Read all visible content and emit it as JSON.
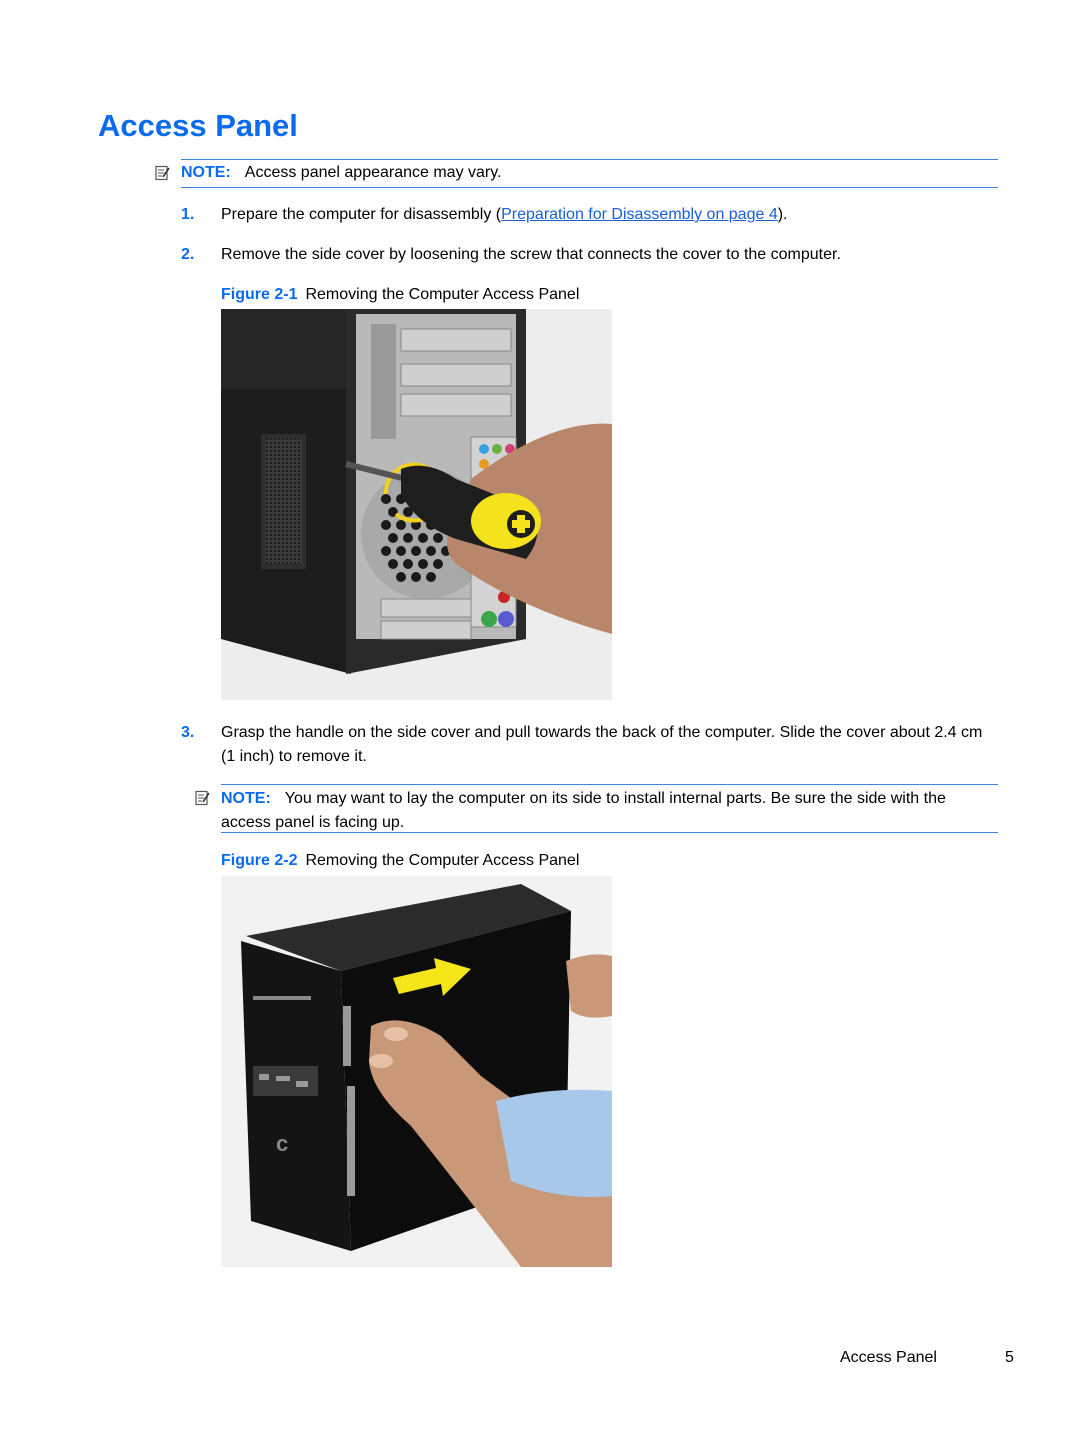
{
  "page": {
    "title": "Access Panel",
    "notes": [
      {
        "label": "NOTE:",
        "text": "Access panel appearance may vary.",
        "icon": "note-icon"
      },
      {
        "label": "NOTE:",
        "text": "You may want to lay the computer on its side to install internal parts. Be sure the side with the access panel is facing up.",
        "icon": "note-icon"
      }
    ],
    "steps": [
      {
        "num": "1.",
        "text_before": "Prepare the computer for disassembly (",
        "link": "Preparation for Disassembly on page 4",
        "text_after": ")."
      },
      {
        "num": "2.",
        "text": "Remove the side cover by loosening the screw that connects the cover to the computer."
      },
      {
        "num": "3.",
        "text": "Grasp the handle on the side cover and pull towards the back of the computer. Slide the cover about 2.4 cm (1 inch) to remove it."
      }
    ],
    "figures": [
      {
        "label": "Figure 2-1",
        "caption": "Removing the Computer Access Panel"
      },
      {
        "label": "Figure 2-2",
        "caption": "Removing the Computer Access Panel"
      }
    ],
    "footer": {
      "section": "Access Panel",
      "page_number": "5"
    },
    "colors": {
      "accent": "#0a6af0",
      "link": "#1a5fd6",
      "rule": "#3b86e6",
      "arrow": "#f5e61a"
    }
  }
}
